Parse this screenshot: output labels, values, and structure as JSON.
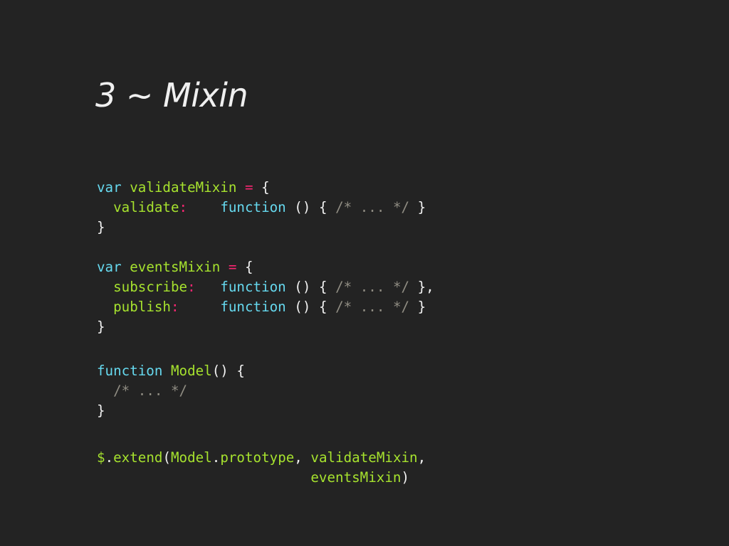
{
  "slide": {
    "title": "3 ~ Mixin"
  },
  "code": {
    "kw_var": "var",
    "kw_function": "function",
    "validate_mixin_name": "validateMixin",
    "events_mixin_name": "eventsMixin",
    "assign_op": "=",
    "open_brace": "{",
    "close_brace": "}",
    "close_brace_comma": "},",
    "parens": "()",
    "colon": ":",
    "comment": "/* ... */",
    "validate_key": "validate",
    "subscribe_key": "subscribe",
    "publish_key": "publish",
    "model_name": "Model",
    "dollar": "$",
    "dot": ".",
    "extend": "extend",
    "open_paren": "(",
    "close_paren": ")",
    "prototype": "prototype",
    "comma": ","
  }
}
